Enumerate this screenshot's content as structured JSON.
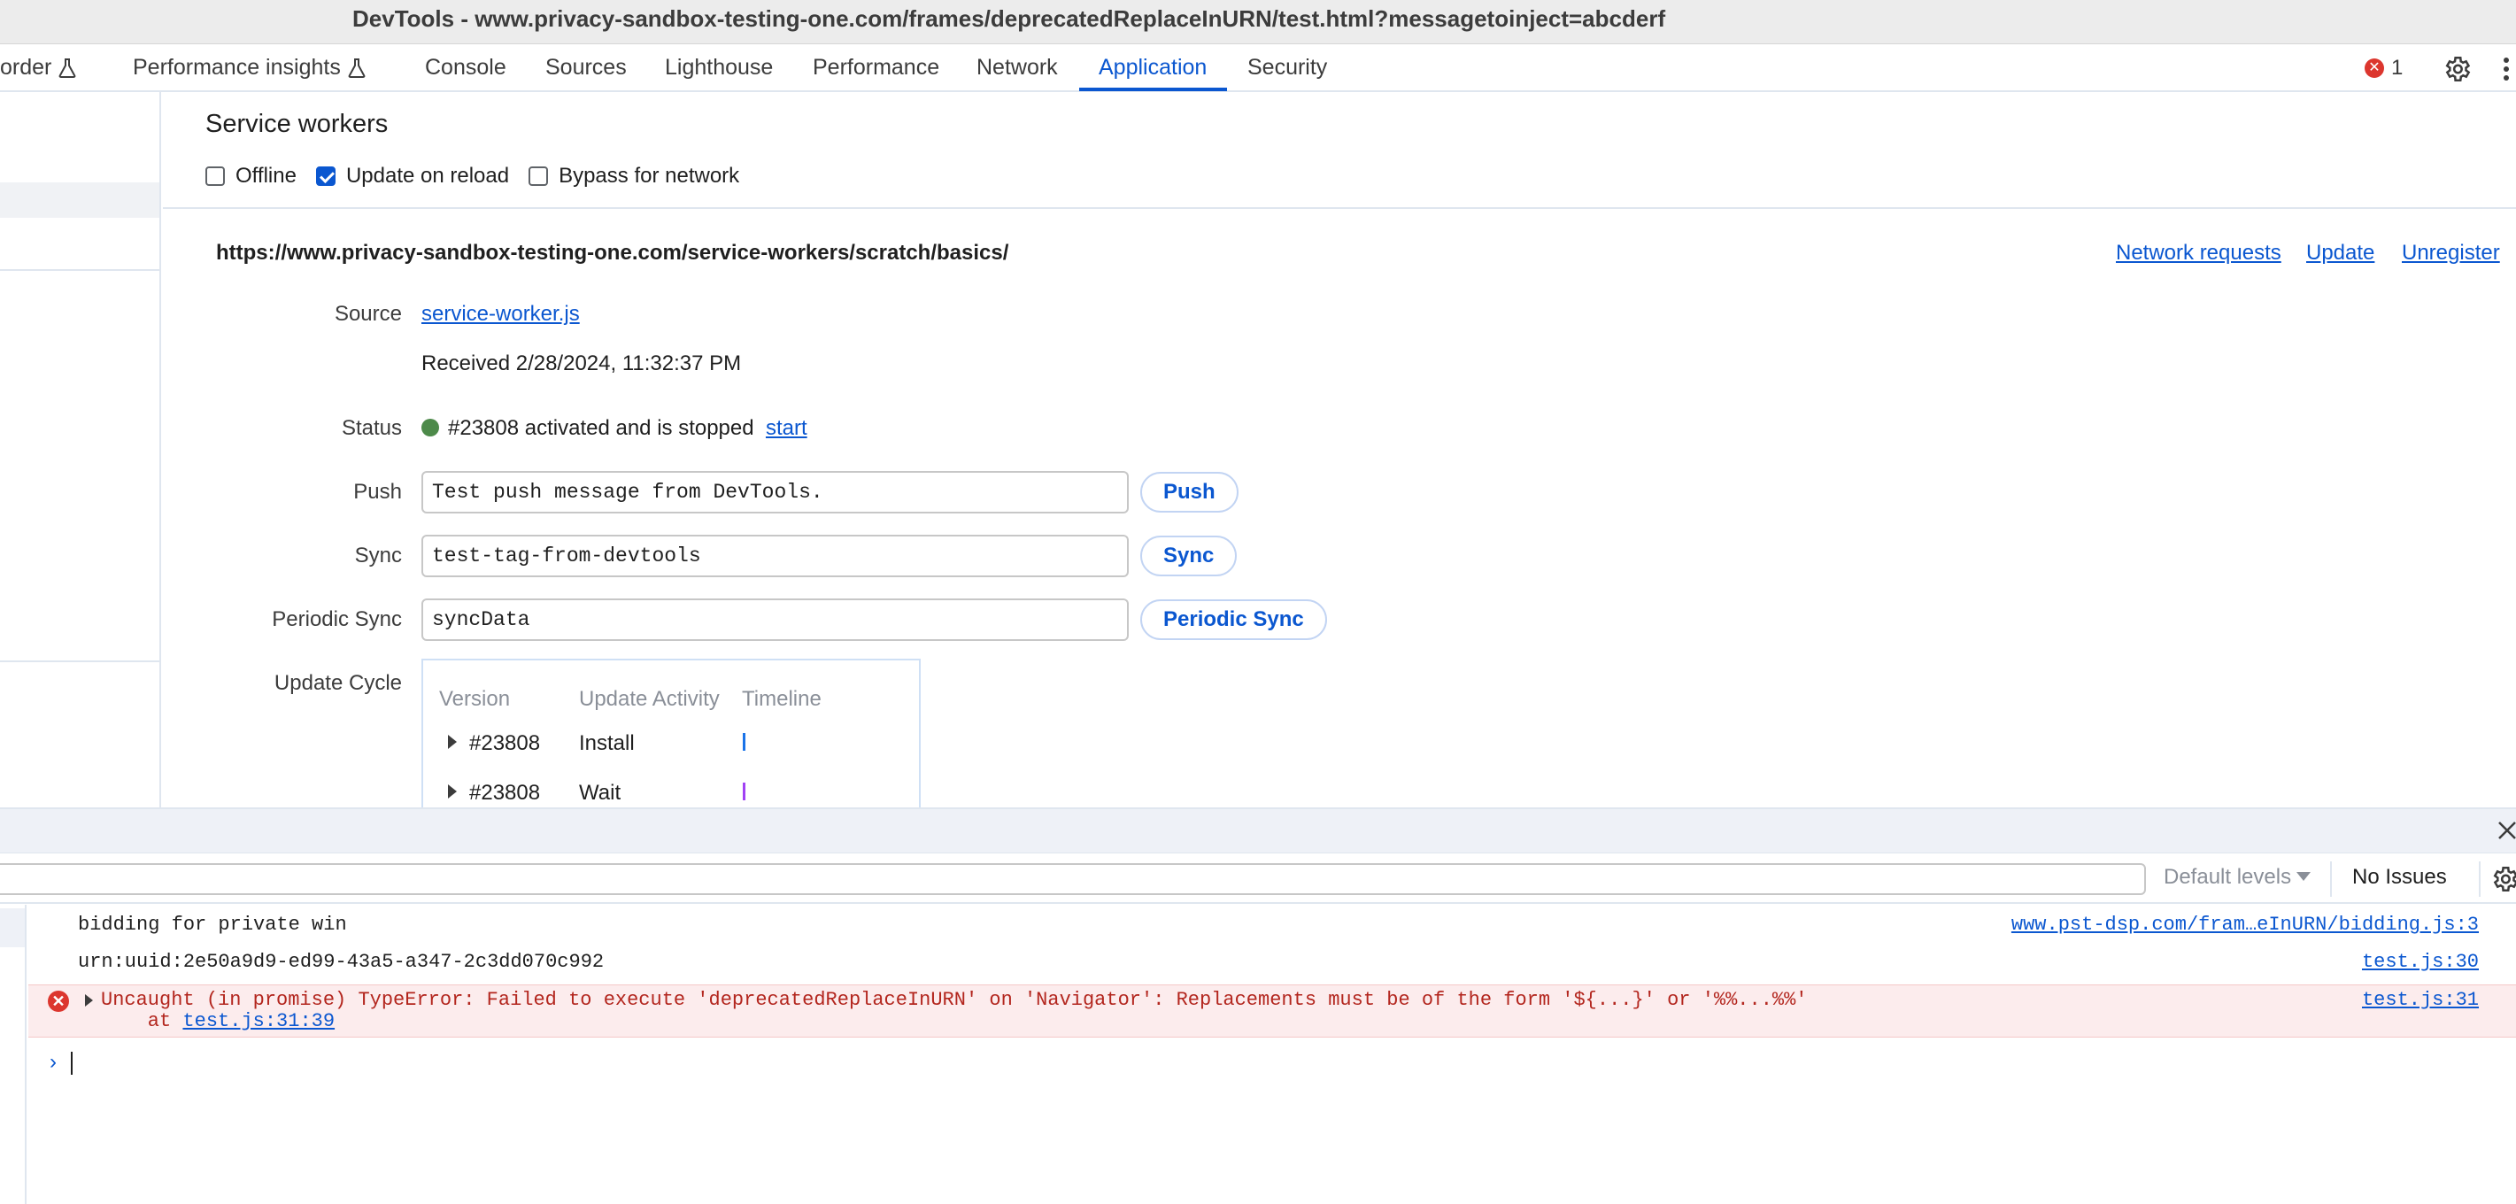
{
  "window": {
    "title": "DevTools - www.privacy-sandbox-testing-one.com/frames/deprecatedReplaceInURN/test.html?messagetoinject=abcderf"
  },
  "tabs": [
    {
      "label": "order",
      "flask": true
    },
    {
      "label": "Performance insights",
      "flask": true
    },
    {
      "label": "Console"
    },
    {
      "label": "Sources"
    },
    {
      "label": "Lighthouse"
    },
    {
      "label": "Performance"
    },
    {
      "label": "Network"
    },
    {
      "label": "Application",
      "active": true
    },
    {
      "label": "Security"
    }
  ],
  "toolbar": {
    "error_count": "1",
    "error_icon": "error-circle-icon",
    "settings_icon": "gear-icon",
    "more_icon": "kebab-menu-icon"
  },
  "service_workers": {
    "title": "Service workers",
    "offline_label": "Offline",
    "offline_checked": false,
    "update_on_reload_label": "Update on reload",
    "update_on_reload_checked": true,
    "bypass_label": "Bypass for network",
    "bypass_checked": false,
    "scope_url": "https://www.privacy-sandbox-testing-one.com/service-workers/scratch/basics/",
    "links": {
      "network_requests": "Network requests",
      "update": "Update",
      "unregister": "Unregister"
    },
    "source_label": "Source",
    "source_link": "service-worker.js",
    "received": "Received 2/28/2024, 11:32:37 PM",
    "status_label": "Status",
    "status_text": "#23808 activated and is stopped",
    "status_color": "#4d8a4a",
    "status_start_link": "start",
    "push_label": "Push",
    "push_value": "Test push message from DevTools.",
    "push_button": "Push",
    "sync_label": "Sync",
    "sync_value": "test-tag-from-devtools",
    "sync_button": "Sync",
    "periodic_sync_label": "Periodic Sync",
    "periodic_sync_value": "syncData",
    "periodic_sync_button": "Periodic Sync",
    "update_cycle_label": "Update Cycle",
    "update_cycle": {
      "headers": [
        "Version",
        "Update Activity",
        "Timeline"
      ],
      "rows": [
        {
          "version": "#23808",
          "activity": "Install",
          "color": "#1a73e8"
        },
        {
          "version": "#23808",
          "activity": "Wait",
          "color": "#a142f4"
        }
      ]
    }
  },
  "console_toolbar": {
    "levels": "Default levels",
    "issues": "No Issues"
  },
  "console": {
    "messages": [
      {
        "text": "bidding for private win",
        "source": "www.pst-dsp.com/fram…eInURN/bidding.js:3"
      },
      {
        "text": "urn:uuid:2e50a9d9-ed99-43a5-a347-2c3dd070c992",
        "source": "test.js:30"
      }
    ],
    "error": {
      "line1": "Uncaught (in promise) TypeError: Failed to execute 'deprecatedReplaceInURN' on 'Navigator': Replacements must be of the form '${...}' or '%%...%%'",
      "line2_prefix": "    at ",
      "line2_link": "test.js:31:39",
      "source": "test.js:31"
    },
    "prompt": "›"
  }
}
